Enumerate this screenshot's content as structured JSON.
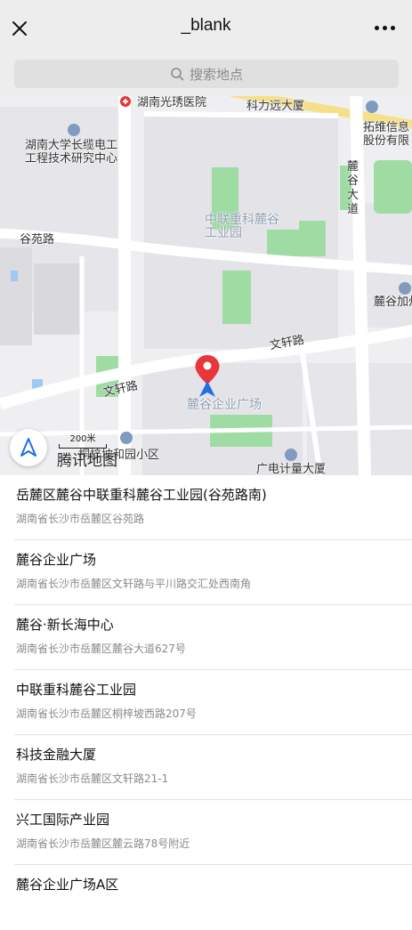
{
  "header": {
    "title": "_blank"
  },
  "search": {
    "placeholder": "搜索地点"
  },
  "map": {
    "labels": {
      "hospital": "湖南光琇医院",
      "tower": "科力远大厦",
      "tuowei": "拓维信息股份有限",
      "university": "湖南大学长缆电工工程技术研究中心",
      "lugu_avenue": "麓谷大道",
      "guyuan_road": "谷苑路",
      "industrial_park": "中联重科麓谷工业园",
      "lugu_plus": "麓谷加州",
      "wenxuan_road_right": "文轩路",
      "wenxuan_road_left": "文轩路",
      "enterprise_plaza": "麓谷企业广场",
      "residential": "桐梓坡和园小区",
      "metrology": "广电计量大厦"
    },
    "scale_label": "200米",
    "brand": "腾讯地图"
  },
  "results": [
    {
      "name": "岳麓区麓谷中联重科麓谷工业园(谷苑路南)",
      "address": "湖南省长沙市岳麓区谷苑路"
    },
    {
      "name": "麓谷企业广场",
      "address": "湖南省长沙市岳麓区文轩路与平川路交汇处西南角"
    },
    {
      "name": "麓谷·新长海中心",
      "address": "湖南省长沙市岳麓区麓谷大道627号"
    },
    {
      "name": "中联重科麓谷工业园",
      "address": "湖南省长沙市岳麓区桐梓坡西路207号"
    },
    {
      "name": "科技金融大厦",
      "address": "湖南省长沙市岳麓区文轩路21-1"
    },
    {
      "name": "兴工国际产业园",
      "address": "湖南省长沙市岳麓区麓云路78号附近"
    },
    {
      "name": "麓谷企业广场A区",
      "address": ""
    }
  ],
  "colors": {
    "header_bg": "#ededed",
    "road": "#ffffff",
    "green": "#9fdca4",
    "block": "#dcdcdf",
    "water": "#9ec9f5",
    "pin_red": "#e8363a",
    "pin_blue": "#1f6fe5",
    "arterial": "#f5e08a"
  }
}
